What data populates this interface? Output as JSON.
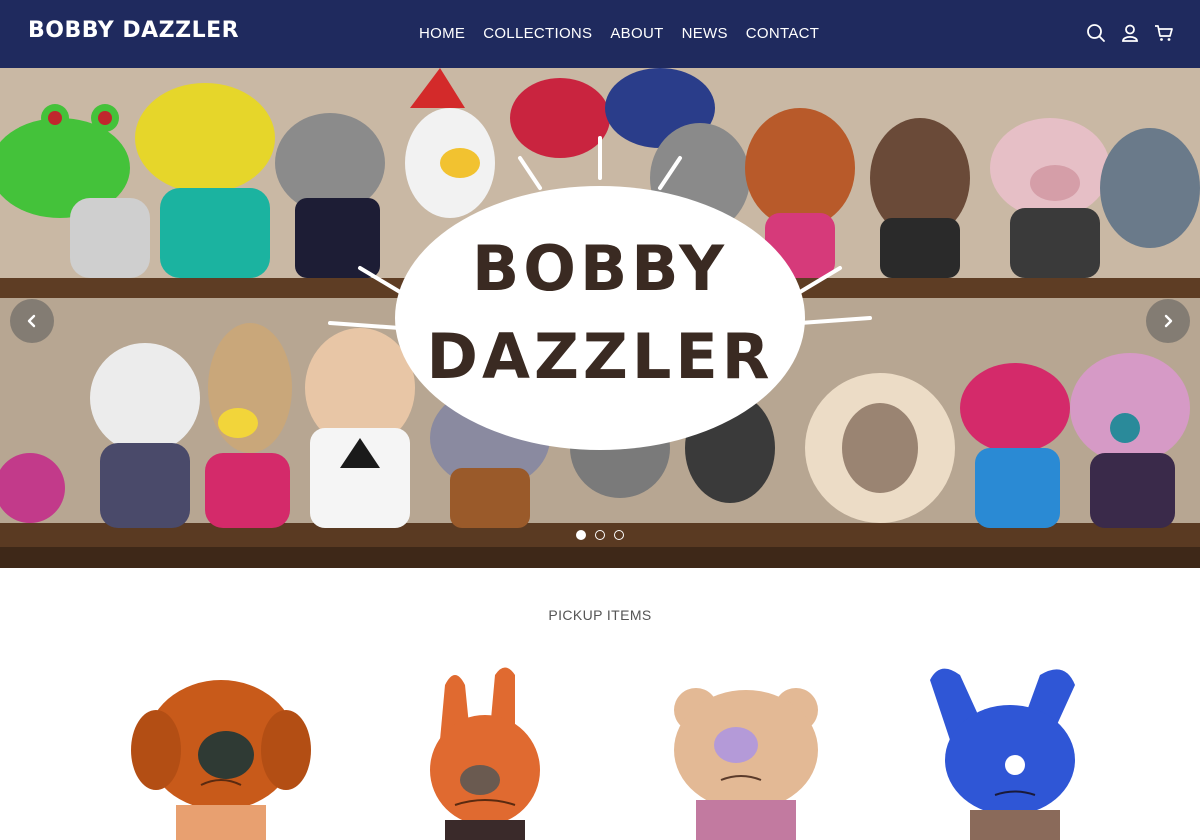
{
  "header": {
    "logo": "BOBBY DAZZLER",
    "nav": [
      "HOME",
      "COLLECTIONS",
      "ABOUT",
      "NEWS",
      "CONTACT"
    ],
    "icons": [
      "search-icon",
      "user-icon",
      "cart-icon"
    ],
    "background": "#1f2a5e"
  },
  "hero": {
    "logo_line1": "BOBBY",
    "logo_line2": "DAZZLER",
    "slides_total": 3,
    "active_slide": 1,
    "prev_icon": "chevron-left-icon",
    "next_icon": "chevron-right-icon"
  },
  "pickup": {
    "title": "PICKUP ITEMS",
    "items": [
      {
        "name": "orange-dog-plush",
        "color": "#d0641e"
      },
      {
        "name": "orange-bunny-plush",
        "color": "#e06a30"
      },
      {
        "name": "beige-bear-plush",
        "color": "#e3b995"
      },
      {
        "name": "blue-bunny-plush",
        "color": "#2f56d6"
      }
    ]
  }
}
